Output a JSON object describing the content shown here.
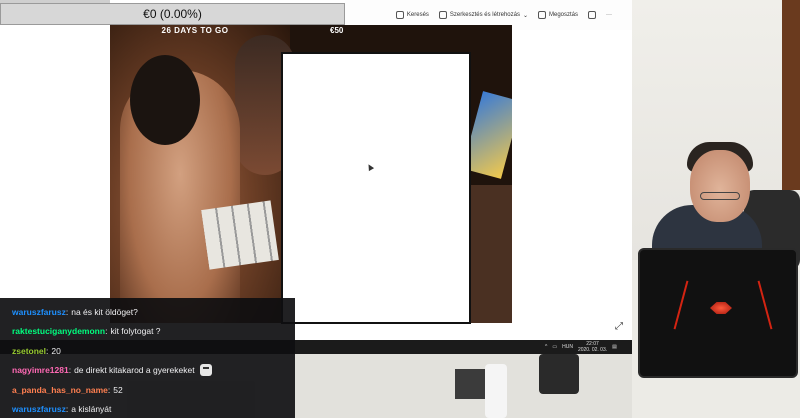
{
  "top_bar": {
    "amount": "€0 (0.00%)"
  },
  "toolbar": {
    "items": [
      {
        "label": "Keresés",
        "icon": "search-icon"
      },
      {
        "label": "Szerkesztés és létrehozás",
        "icon": "edit-icon"
      },
      {
        "label": "Megosztás",
        "icon": "share-icon"
      }
    ]
  },
  "overlay": {
    "countdown": "26 DAYS TO GO",
    "price": "€50"
  },
  "taskbar": {
    "lang": "HUN",
    "time": "22:07",
    "date": "2020. 02. 03."
  },
  "chat": {
    "messages": [
      {
        "user": "waruszfarusz",
        "text": "na és kit öldöget?",
        "color": "#1e90ff"
      },
      {
        "user": "raktestuciganydemonn",
        "text": "kit folytogat ?",
        "color": "#00ff7f"
      },
      {
        "user": "zsetonel",
        "text": "20",
        "color": "#9acd32"
      },
      {
        "user": "nagyimre1281",
        "text": "de direkt kitakarod a gyerekeket",
        "color": "#ff69b4",
        "emote": "face-emote-icon"
      },
      {
        "user": "a_panda_has_no_name",
        "text": "52",
        "color": "#ff7f50"
      },
      {
        "user": "waruszfarusz",
        "text": "a kislányát",
        "color": "#1e90ff"
      }
    ]
  }
}
